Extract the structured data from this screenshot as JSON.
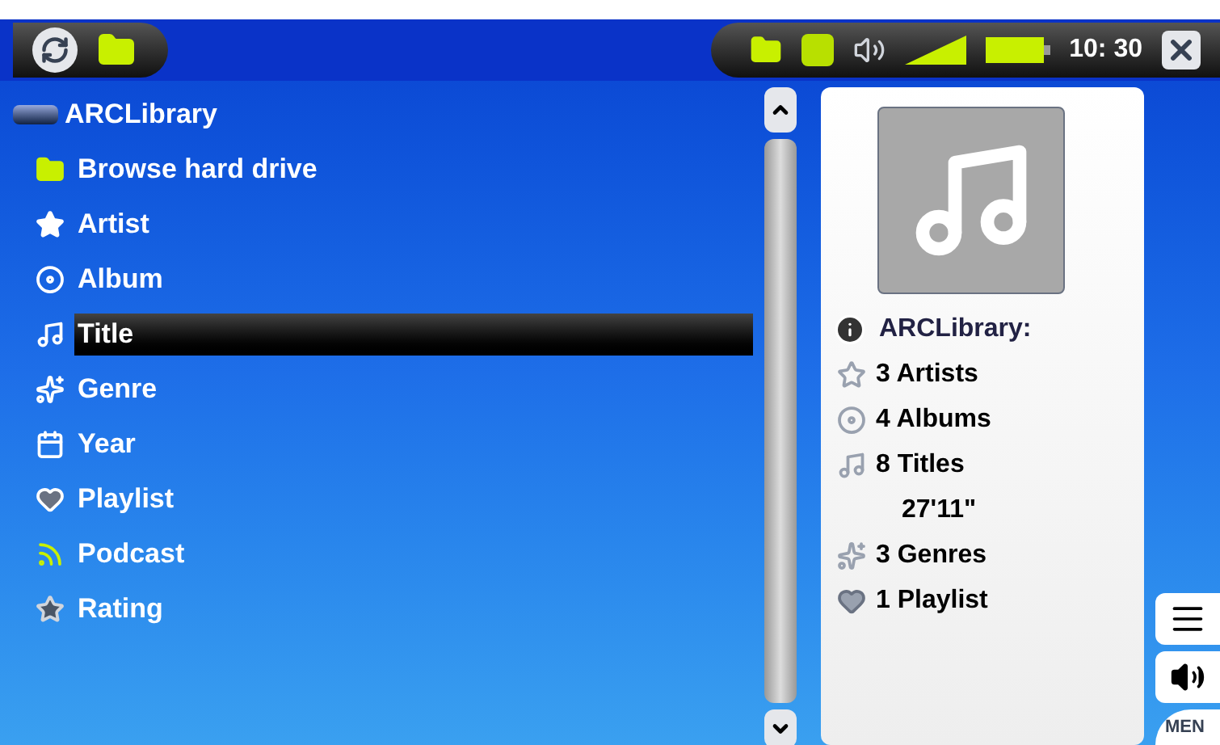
{
  "status_bar": {
    "time": "10: 30"
  },
  "library": {
    "title": "ARCLibrary",
    "items": [
      {
        "label": "Browse hard drive",
        "kind": "folder",
        "selected": false
      },
      {
        "label": "Artist",
        "kind": "artist",
        "selected": false
      },
      {
        "label": "Album",
        "kind": "album",
        "selected": false
      },
      {
        "label": "Title",
        "kind": "title",
        "selected": true
      },
      {
        "label": "Genre",
        "kind": "genre",
        "selected": false
      },
      {
        "label": "Year",
        "kind": "year",
        "selected": false
      },
      {
        "label": "Playlist",
        "kind": "playlist",
        "selected": false
      },
      {
        "label": "Podcast",
        "kind": "podcast",
        "selected": false
      },
      {
        "label": "Rating",
        "kind": "rating",
        "selected": false
      }
    ]
  },
  "info_panel": {
    "title": "ARCLibrary:",
    "stats": [
      {
        "kind": "artist",
        "text": "3 Artists"
      },
      {
        "kind": "album",
        "text": "4 Albums"
      },
      {
        "kind": "title",
        "text": "8 Titles"
      },
      {
        "kind": "duration",
        "text": "27'11\""
      },
      {
        "kind": "genre",
        "text": "3 Genres"
      },
      {
        "kind": "playlist",
        "text": "1 Playlist"
      }
    ]
  },
  "side_buttons": {
    "menu_label": "MEN"
  }
}
